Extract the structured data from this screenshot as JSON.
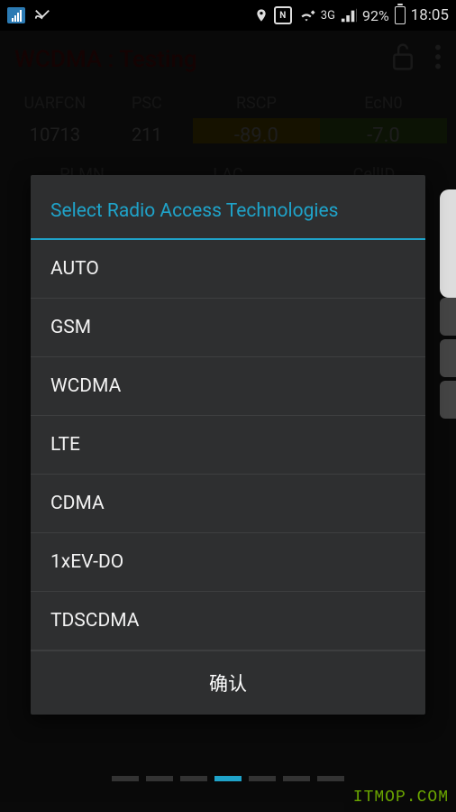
{
  "status_bar": {
    "network_type": "3G",
    "battery_pct": "92%",
    "clock": "18:05",
    "nfc_label": "N"
  },
  "header": {
    "title": "WCDMA : Testing"
  },
  "cells": {
    "row1": {
      "h1": "UARFCN",
      "v1": "10713",
      "h2": "PSC",
      "v2": "211",
      "h3": "RSCP",
      "v3": "-89.0",
      "h4": "EcN0",
      "v4": "-7.0"
    },
    "row2": {
      "h1": "PLMN",
      "h2": "LAC",
      "h3": "CellID"
    }
  },
  "dialog": {
    "title": "Select Radio Access Technologies",
    "options": {
      "0": "AUTO",
      "1": "GSM",
      "2": "WCDMA",
      "3": "LTE",
      "4": "CDMA",
      "5": "1xEV-DO",
      "6": "TDSCDMA"
    },
    "confirm_label": "确认"
  },
  "watermark": "ITMOP.COM"
}
